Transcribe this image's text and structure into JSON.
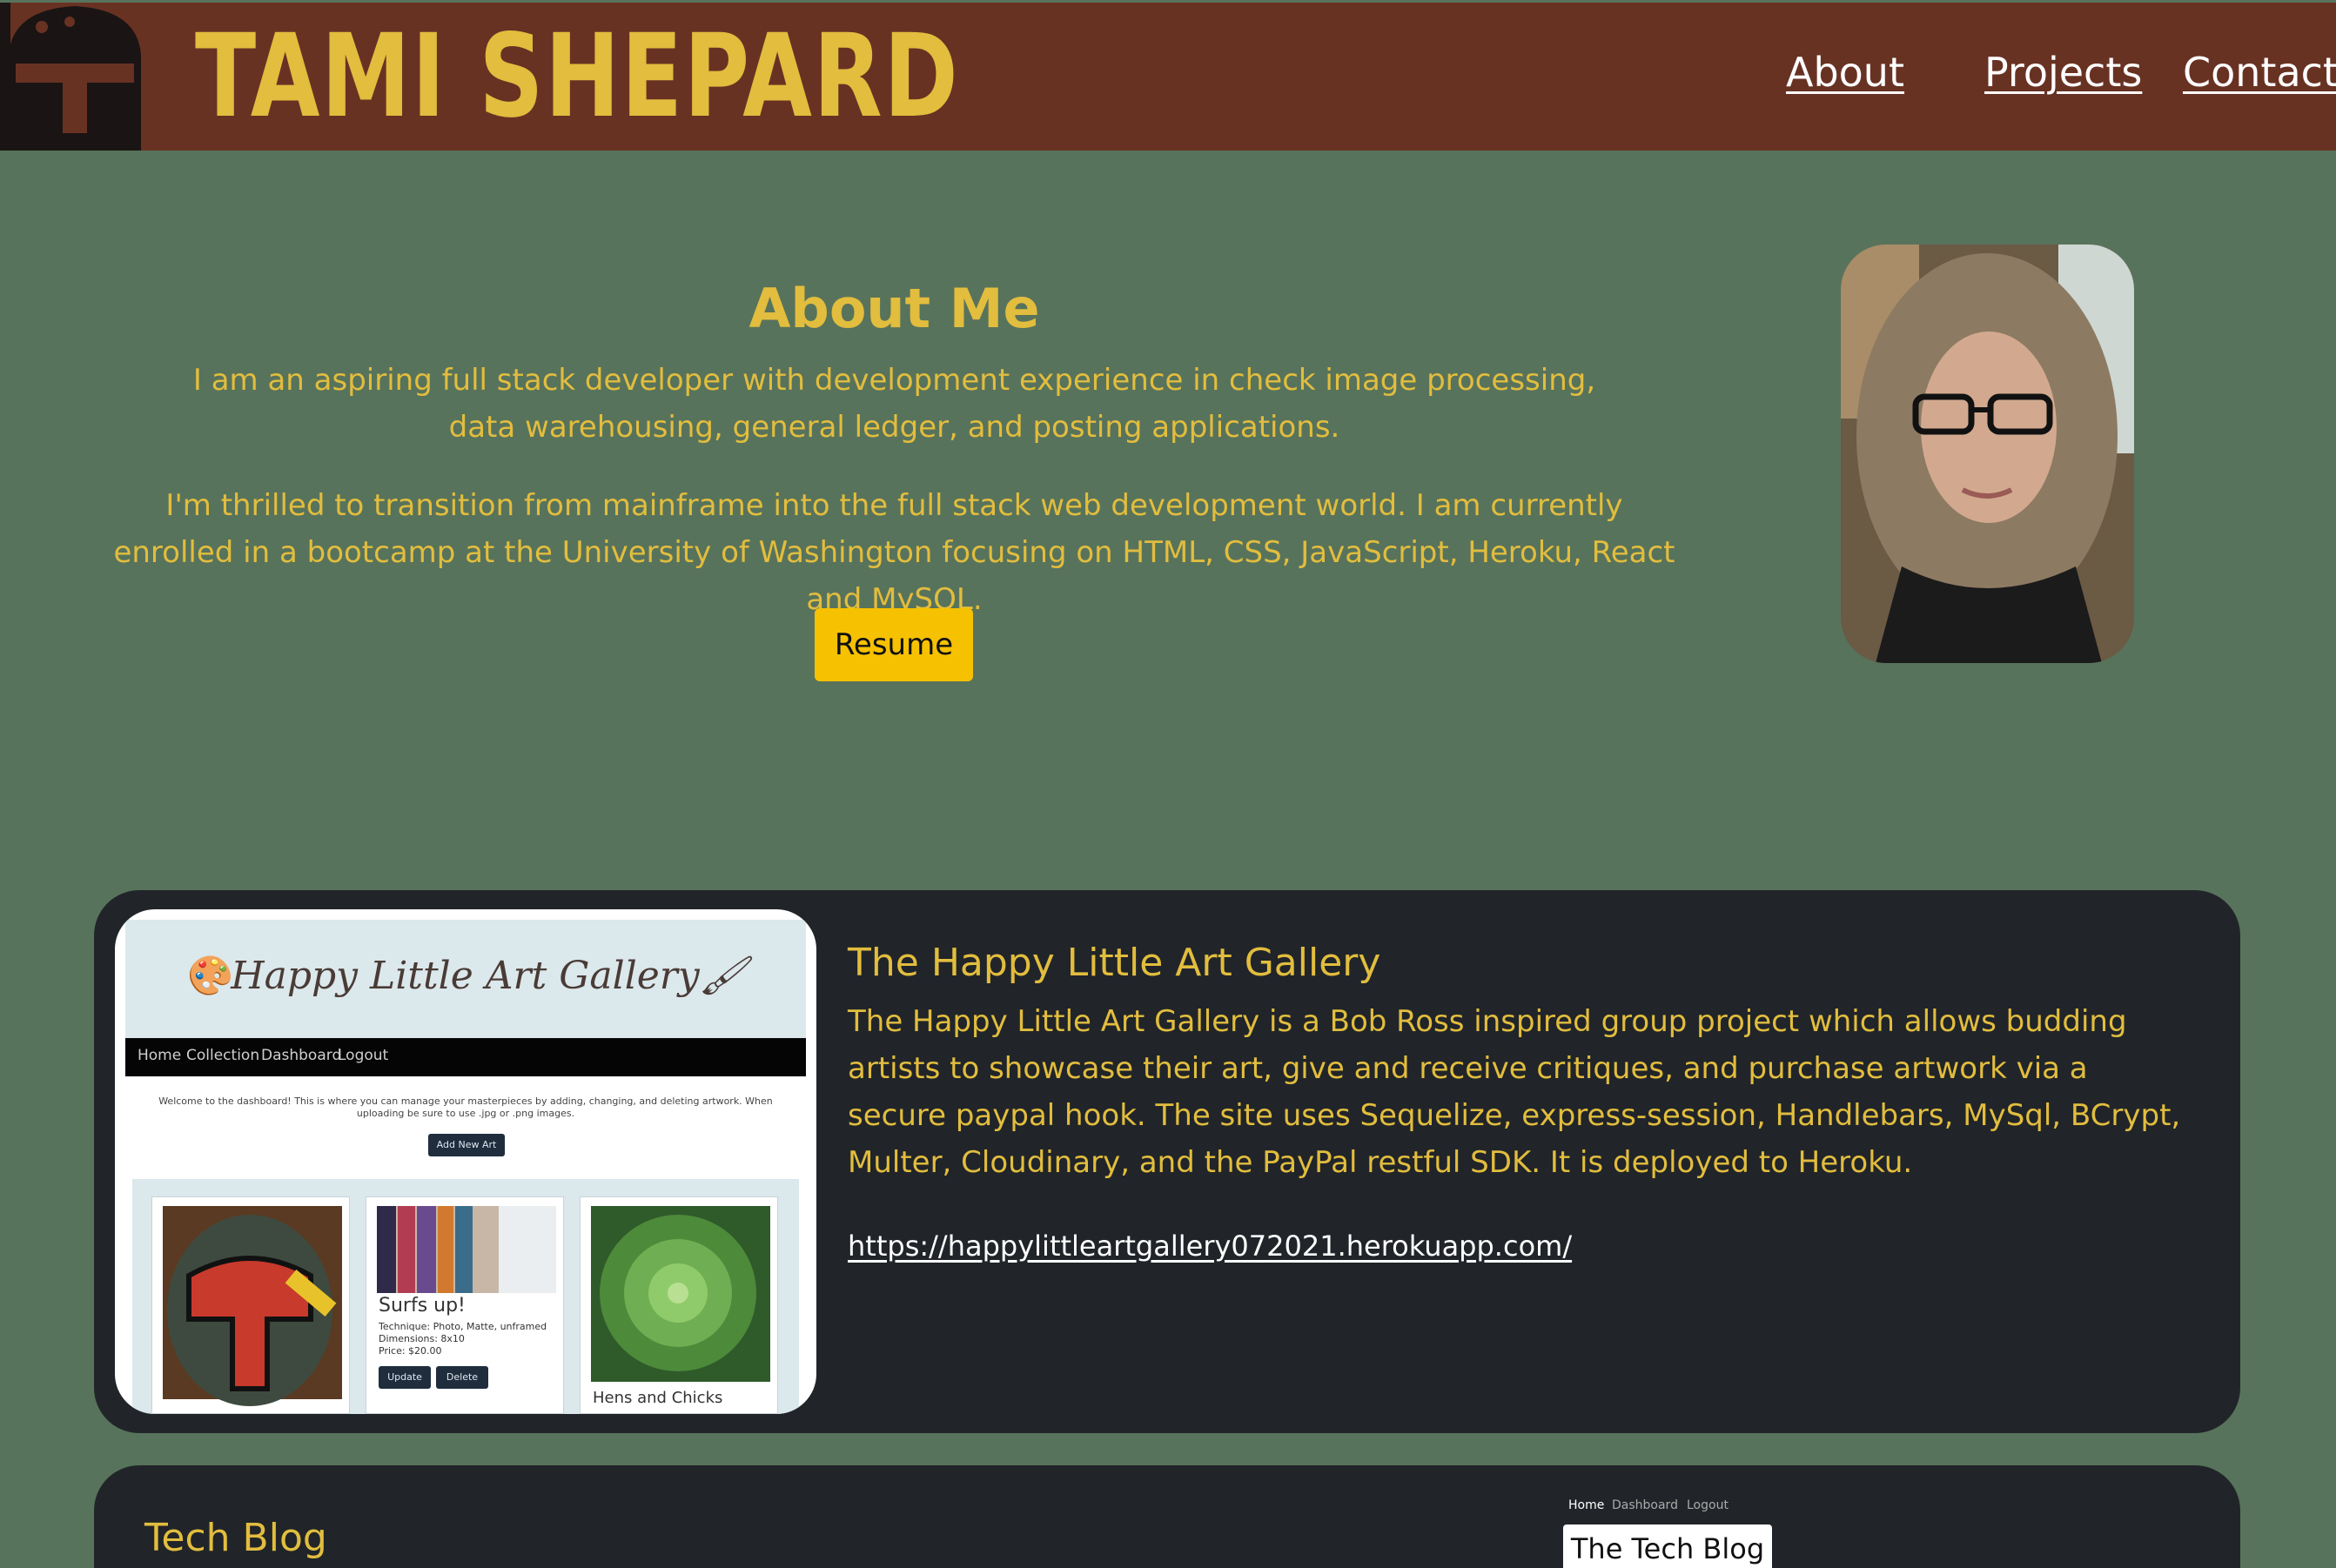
{
  "header": {
    "brand": "TAMI SHEPARD",
    "logo_icon": "mandalorian-helmet-icon",
    "nav": [
      "About",
      "Projects",
      "Contact"
    ],
    "colors": {
      "bar": "#683223",
      "brand": "#e2bd3e"
    }
  },
  "about": {
    "title": "About Me",
    "p1": "I am an aspiring full stack developer with development experience in check image processing, data warehousing, general ledger, and posting applications.",
    "p2": "I'm thrilled to transition from mainframe into the full stack web development world. I am currently enrolled in a bootcamp at the University of Washington focusing on HTML, CSS, JavaScript, Heroku, React and MySQL.",
    "resume_label": "Resume",
    "portrait": "profile-photo"
  },
  "projects": [
    {
      "title": "The Happy Little Art Gallery",
      "description": "The Happy Little Art Gallery is a Bob Ross inspired group project which allows budding artists to showcase their art, give and receive critiques, and purchase artwork via a secure paypal hook. The site uses Sequelize, express-session, Handlebars, MySql, BCrypt, Multer, Cloudinary, and the PayPal restful SDK. It is deployed to Heroku.",
      "link": "https://happylittleartgallery072021.herokuapp.com/",
      "screenshot": {
        "title": "Happy Little Art Gallery",
        "nav": [
          "Home",
          "Collection",
          "Dashboard",
          "Logout"
        ],
        "welcome": "Welcome to the dashboard! This is where you can manage your masterpieces by adding, changing, and deleting artwork. When uploading be sure to use .jpg or .png images.",
        "add_button": "Add New Art",
        "card2_title": "Surfs up!",
        "card2_details": [
          "Technique: Photo, Matte, unframed",
          "Dimensions: 8x10",
          "Price: $20.00"
        ],
        "card2_buttons": [
          "Update",
          "Delete"
        ],
        "card3_title": "Hens and Chicks"
      }
    },
    {
      "title": "Tech Blog",
      "screenshot": {
        "nav": [
          "Home",
          "Dashboard",
          "Logout"
        ],
        "title": "The Tech Blog"
      }
    }
  ]
}
